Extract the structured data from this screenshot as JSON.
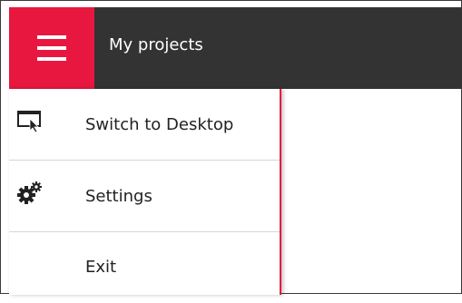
{
  "header": {
    "title": "My projects",
    "menu_icon": "hamburger-menu-icon",
    "accent_color": "#e8173f",
    "bar_color": "#333333"
  },
  "menu": {
    "items": [
      {
        "label": "Switch to Desktop",
        "icon": "switch-to-desktop-icon"
      },
      {
        "label": "Settings",
        "icon": "settings-gears-icon"
      },
      {
        "label": "Exit",
        "icon": ""
      }
    ]
  }
}
